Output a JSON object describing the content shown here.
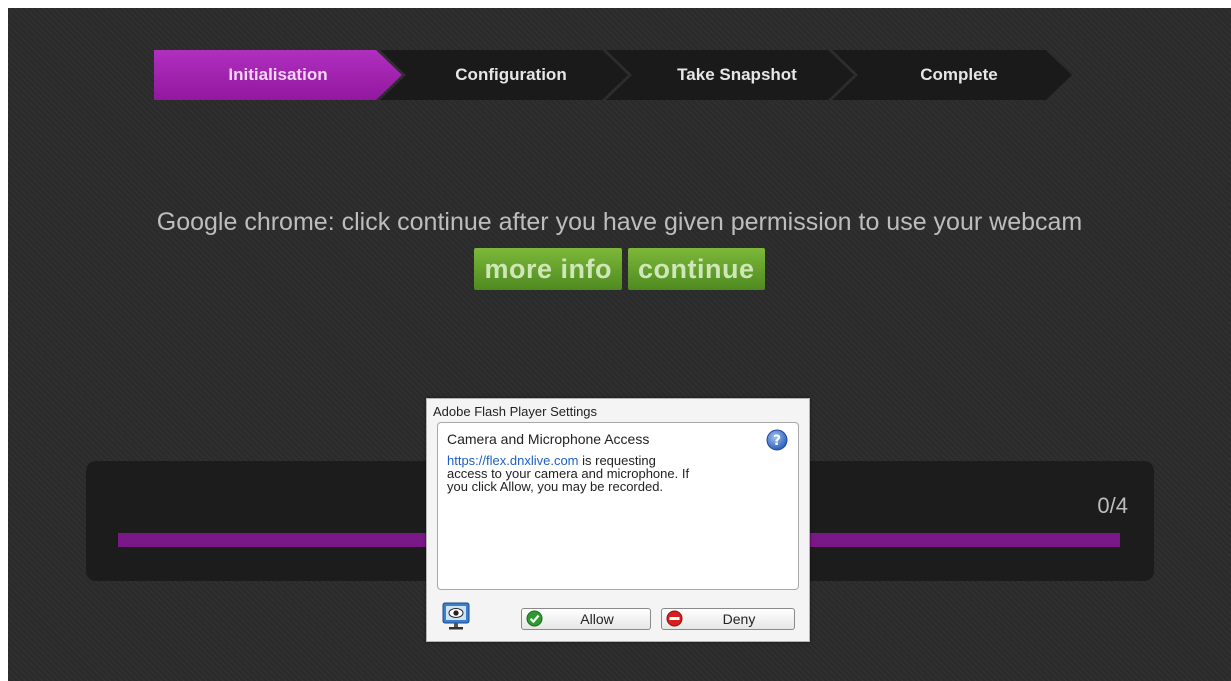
{
  "stepper": {
    "steps": [
      {
        "label": "Initialisation",
        "active": true
      },
      {
        "label": "Configuration",
        "active": false
      },
      {
        "label": "Take Snapshot",
        "active": false
      },
      {
        "label": "Complete",
        "active": false
      }
    ]
  },
  "message": {
    "text": "Google chrome: click continue after you have given permission to use your webcam"
  },
  "buttons": {
    "more_info": "more info",
    "continue": "continue"
  },
  "progress": {
    "count": "0/4",
    "fraction": 0.0
  },
  "flash_dialog": {
    "title": "Adobe Flash Player Settings",
    "heading": "Camera and Microphone Access",
    "link": "https://flex.dnxlive.com",
    "body_line1_rest": " is requesting",
    "body_line2": "access to your camera and microphone. If",
    "body_line3": "you click Allow, you may be recorded.",
    "allow": "Allow",
    "deny": "Deny",
    "icons": [
      "help-icon",
      "webcam-settings-icon",
      "check-icon",
      "deny-icon"
    ]
  },
  "colors": {
    "active_step": "#a024b0",
    "progress_fill": "#7a1887",
    "green_button": "#6aa531",
    "link": "#1f5fc4"
  }
}
